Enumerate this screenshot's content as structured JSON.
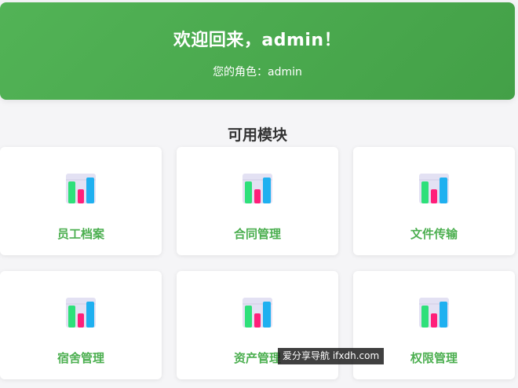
{
  "banner": {
    "title": "欢迎回来，admin！",
    "role": "您的角色：admin",
    "color": "#4caf50"
  },
  "modules": {
    "title": "可用模块",
    "items": [
      {
        "label": "员工档案",
        "icon": "bar-chart-icon"
      },
      {
        "label": "合同管理",
        "icon": "bar-chart-icon"
      },
      {
        "label": "文件传输",
        "icon": "bar-chart-icon"
      },
      {
        "label": "宿舍管理",
        "icon": "bar-chart-icon"
      },
      {
        "label": "资产管理",
        "icon": "bar-chart-icon"
      },
      {
        "label": "权限管理",
        "icon": "bar-chart-icon"
      }
    ]
  },
  "watermark": {
    "text": "爱分享导航 ifxdh.com"
  }
}
